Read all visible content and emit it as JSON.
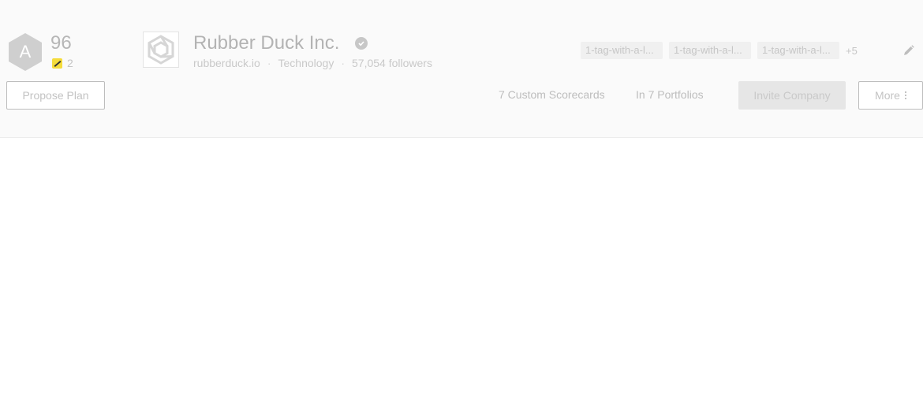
{
  "grade": {
    "letter": "A",
    "score": "96",
    "issue_count": "2",
    "badge_color": "#cfcfcf"
  },
  "company": {
    "name": "Rubber Duck Inc.",
    "domain": "rubberduck.io",
    "industry": "Technology",
    "followers": "57,054 followers",
    "separator": "·"
  },
  "tags": {
    "items": [
      "1-tag-with-a-l...",
      "1-tag-with-a-l...",
      "1-tag-with-a-l..."
    ],
    "more_label": "+5"
  },
  "actions": {
    "propose_plan": "Propose Plan",
    "custom_scorecards": "7 Custom Scorecards",
    "portfolios": "In 7 Portfolios",
    "invite_company": "Invite Company",
    "more": "More"
  },
  "icons": {
    "grade": "hexagon-icon",
    "issue": "warning-icon",
    "logo": "hexagon-knot-logo",
    "verified": "verified-icon",
    "edit": "pencil-icon",
    "more": "kebab-icon"
  }
}
